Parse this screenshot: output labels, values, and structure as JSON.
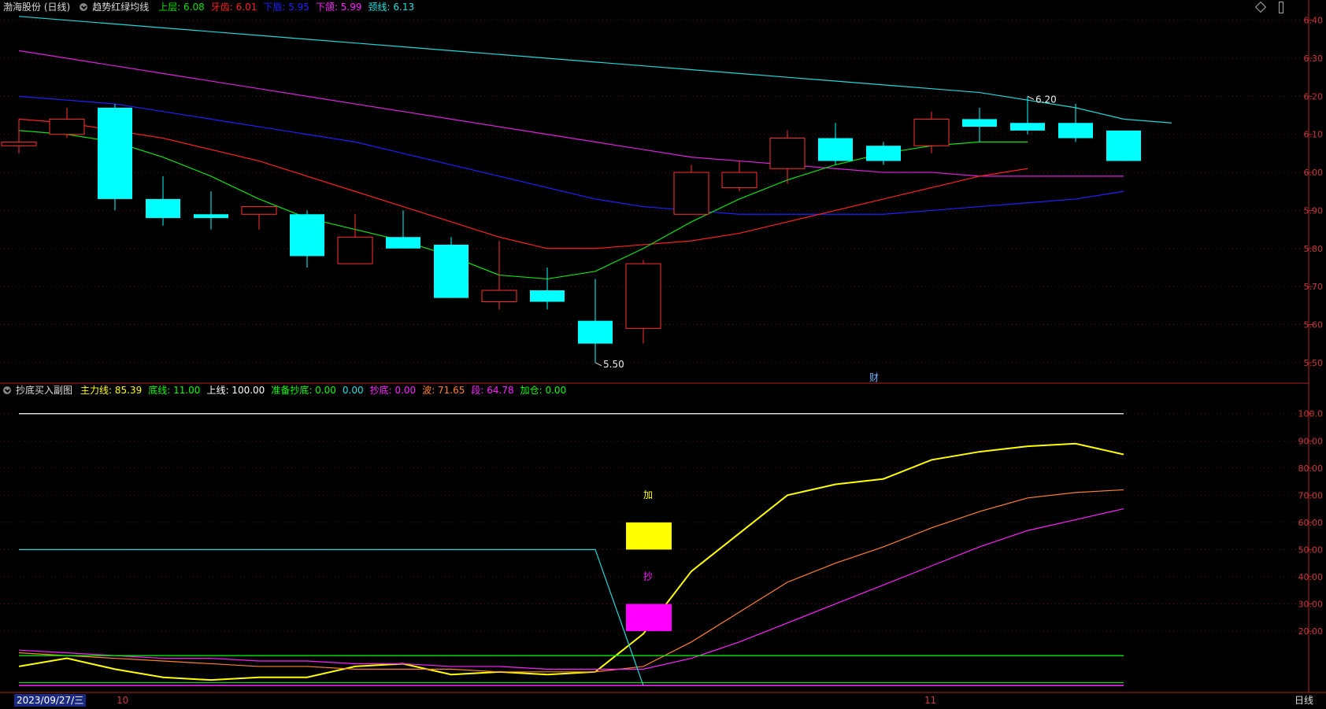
{
  "main_panel": {
    "title": "渤海股份 (日线)",
    "indicator_name": "趋势红绿均线",
    "legend": [
      {
        "label": "上层:",
        "value": "6.08",
        "color": "#00e000"
      },
      {
        "label": "牙齿:",
        "value": "6.01",
        "color": "#ff2020"
      },
      {
        "label": "下唇:",
        "value": "5.95",
        "color": "#2020ff"
      },
      {
        "label": "下颌:",
        "value": "5.99",
        "color": "#ff20ff"
      },
      {
        "label": "颈线:",
        "value": "6.13",
        "color": "#20e0e0"
      }
    ],
    "y_ticks": [
      "6.40",
      "6.30",
      "6.20",
      "6.10",
      "6.00",
      "5.90",
      "5.80",
      "5.70",
      "5.60",
      "5.50"
    ],
    "high_label": "6.20",
    "low_label": "5.50",
    "event_marker": "财",
    "diamond_icon": "diamond-icon",
    "scroll_icon": "scrollbar-icon"
  },
  "sub_panel": {
    "indicator_name": "抄底买入副图",
    "legend": [
      {
        "label": "主力线:",
        "value": "85.39",
        "color": "#ffff00"
      },
      {
        "label": "底线:",
        "value": "11.00",
        "color": "#00ff00"
      },
      {
        "label": "上线:",
        "value": "100.00",
        "color": "#ffffff"
      },
      {
        "label": "准备抄底:",
        "value": "0.00",
        "color": "#00ff00"
      },
      {
        "label": "",
        "value": "0.00",
        "color": "#20e0e0"
      },
      {
        "label": "抄底:",
        "value": "0.00",
        "color": "#ff20ff"
      },
      {
        "label": "波:",
        "value": "71.65",
        "color": "#ff8030"
      },
      {
        "label": "段:",
        "value": "64.78",
        "color": "#ff20ff"
      },
      {
        "label": "加仓:",
        "value": "0.00",
        "color": "#00ff00"
      }
    ],
    "y_ticks": [
      "100.0",
      "90.00",
      "80.00",
      "70.00",
      "60.00",
      "50.00",
      "40.00",
      "30.00",
      "20.00"
    ],
    "marker_add": "加",
    "marker_buy": "抄"
  },
  "time_axis": {
    "current_date": "2023/09/27/三",
    "month_labels": [
      "10",
      "11"
    ],
    "period_tab": "日线"
  },
  "chart_data": {
    "type": "candlestick",
    "title": "渤海股份 (日线)",
    "ylim": [
      5.45,
      6.42
    ],
    "candles": [
      {
        "o": 6.07,
        "h": 6.14,
        "l": 6.05,
        "c": 6.08
      },
      {
        "o": 6.1,
        "h": 6.17,
        "l": 6.09,
        "c": 6.14
      },
      {
        "o": 6.17,
        "h": 6.18,
        "l": 5.9,
        "c": 5.93
      },
      {
        "o": 5.93,
        "h": 5.99,
        "l": 5.86,
        "c": 5.88
      },
      {
        "o": 5.89,
        "h": 5.95,
        "l": 5.85,
        "c": 5.88
      },
      {
        "o": 5.89,
        "h": 5.91,
        "l": 5.85,
        "c": 5.91
      },
      {
        "o": 5.89,
        "h": 5.9,
        "l": 5.75,
        "c": 5.78
      },
      {
        "o": 5.76,
        "h": 5.89,
        "l": 5.76,
        "c": 5.83
      },
      {
        "o": 5.83,
        "h": 5.9,
        "l": 5.8,
        "c": 5.8
      },
      {
        "o": 5.81,
        "h": 5.83,
        "l": 5.67,
        "c": 5.67
      },
      {
        "o": 5.66,
        "h": 5.82,
        "l": 5.64,
        "c": 5.69
      },
      {
        "o": 5.69,
        "h": 5.75,
        "l": 5.64,
        "c": 5.66
      },
      {
        "o": 5.61,
        "h": 5.72,
        "l": 5.5,
        "c": 5.55
      },
      {
        "o": 5.59,
        "h": 5.77,
        "l": 5.55,
        "c": 5.76
      },
      {
        "o": 5.89,
        "h": 6.02,
        "l": 5.89,
        "c": 6.0
      },
      {
        "o": 5.96,
        "h": 6.03,
        "l": 5.95,
        "c": 6.0
      },
      {
        "o": 6.01,
        "h": 6.11,
        "l": 5.97,
        "c": 6.09
      },
      {
        "o": 6.09,
        "h": 6.13,
        "l": 6.02,
        "c": 6.03
      },
      {
        "o": 6.07,
        "h": 6.08,
        "l": 6.02,
        "c": 6.03
      },
      {
        "o": 6.07,
        "h": 6.16,
        "l": 6.05,
        "c": 6.14
      },
      {
        "o": 6.14,
        "h": 6.17,
        "l": 6.08,
        "c": 6.12
      },
      {
        "o": 6.13,
        "h": 6.2,
        "l": 6.1,
        "c": 6.11
      },
      {
        "o": 6.13,
        "h": 6.18,
        "l": 6.08,
        "c": 6.09
      },
      {
        "o": 6.11,
        "h": 6.11,
        "l": 6.03,
        "c": 6.03
      }
    ],
    "lines": [
      {
        "name": "颈线",
        "color": "#20d8d8",
        "values": [
          6.41,
          6.4,
          6.39,
          6.38,
          6.37,
          6.36,
          6.35,
          6.34,
          6.33,
          6.32,
          6.31,
          6.3,
          6.29,
          6.28,
          6.27,
          6.26,
          6.25,
          6.24,
          6.23,
          6.22,
          6.21,
          6.19,
          6.17,
          6.14,
          6.13
        ]
      },
      {
        "name": "下颌",
        "color": "#e020e0",
        "values": [
          6.32,
          6.3,
          6.28,
          6.26,
          6.24,
          6.22,
          6.2,
          6.18,
          6.16,
          6.14,
          6.12,
          6.1,
          6.08,
          6.06,
          6.04,
          6.03,
          6.02,
          6.01,
          6.0,
          6.0,
          5.99,
          5.99,
          5.99,
          5.99
        ]
      },
      {
        "name": "下唇",
        "color": "#2020ff",
        "values": [
          6.2,
          6.19,
          6.18,
          6.16,
          6.14,
          6.12,
          6.1,
          6.08,
          6.05,
          6.02,
          5.99,
          5.96,
          5.93,
          5.91,
          5.9,
          5.89,
          5.89,
          5.89,
          5.89,
          5.9,
          5.91,
          5.92,
          5.93,
          5.95
        ]
      },
      {
        "name": "牙齿",
        "color": "#ff2020",
        "values": [
          6.14,
          6.13,
          6.11,
          6.09,
          6.06,
          6.03,
          5.99,
          5.95,
          5.91,
          5.87,
          5.83,
          5.8,
          5.8,
          5.81,
          5.82,
          5.84,
          5.87,
          5.9,
          5.93,
          5.96,
          5.99,
          6.01
        ]
      },
      {
        "name": "上层",
        "color": "#10e010",
        "values": [
          6.11,
          6.1,
          6.08,
          6.04,
          5.99,
          5.93,
          5.88,
          5.85,
          5.82,
          5.78,
          5.73,
          5.72,
          5.74,
          5.8,
          5.87,
          5.93,
          5.98,
          6.02,
          6.05,
          6.07,
          6.08,
          6.08
        ]
      },
      {
        "name_hidden": true
      }
    ],
    "sub_ylim": [
      -2,
      106
    ],
    "sub_series": [
      {
        "name": "主力线",
        "color": "#ffff00",
        "values": [
          7,
          10,
          6,
          3,
          2,
          3,
          3,
          7,
          8,
          4,
          5,
          4,
          5,
          19,
          42,
          56,
          70,
          74,
          76,
          83,
          86,
          88,
          89,
          85
        ]
      },
      {
        "name": "波",
        "color": "#ff8030",
        "values": [
          12,
          11,
          10,
          9,
          8,
          7,
          7,
          6,
          6,
          6,
          5,
          5,
          5,
          7,
          16,
          27,
          38,
          45,
          51,
          58,
          64,
          69,
          71,
          72
        ]
      },
      {
        "name": "段",
        "color": "#ff20ff",
        "values": [
          13,
          12,
          11,
          10,
          10,
          9,
          9,
          8,
          8,
          7,
          7,
          6,
          6,
          6,
          10,
          16,
          23,
          30,
          37,
          44,
          51,
          57,
          61,
          65
        ]
      },
      {
        "name": "底线",
        "color": "#00ff00",
        "values": [
          11,
          11,
          11,
          11,
          11,
          11,
          11,
          11,
          11,
          11,
          11,
          11,
          11,
          11,
          11,
          11,
          11,
          11,
          11,
          11,
          11,
          11,
          11,
          11
        ]
      },
      {
        "name": "上线",
        "color": "#ffffff",
        "values": [
          100,
          100,
          100,
          100,
          100,
          100,
          100,
          100,
          100,
          100,
          100,
          100,
          100,
          100,
          100,
          100,
          100,
          100,
          100,
          100,
          100,
          100,
          100,
          100
        ]
      }
    ],
    "sub_cyan_step": [
      50,
      50,
      50,
      50,
      50,
      50,
      50,
      50,
      50,
      50,
      50,
      50,
      50,
      0,
      0,
      0,
      0,
      0,
      0,
      0,
      0,
      0,
      0,
      0
    ],
    "sub_bars": [
      {
        "index": 13,
        "from": 50,
        "to": 60,
        "color": "#ffff00"
      },
      {
        "index": 13,
        "from": 20,
        "to": 30,
        "color": "#ff00ff"
      }
    ]
  }
}
